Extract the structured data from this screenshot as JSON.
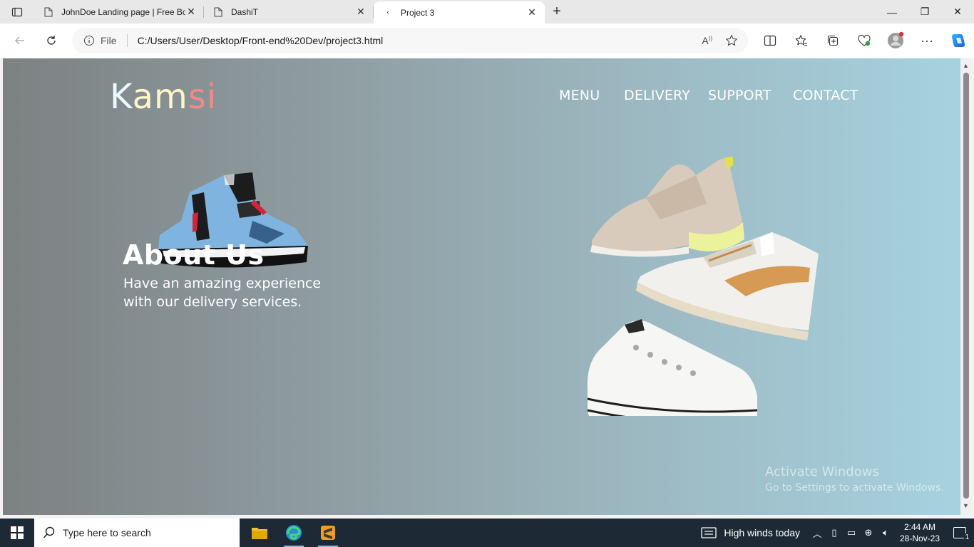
{
  "browser": {
    "tabs": [
      {
        "title": "JohnDoe Landing page | Free Bo",
        "active": false
      },
      {
        "title": "DashiT",
        "active": false
      },
      {
        "title": "Project 3",
        "active": true
      }
    ],
    "address": {
      "scheme_label": "File",
      "url": "C:/Users/User/Desktop/Front-end%20Dev/project3.html"
    }
  },
  "page": {
    "logo": {
      "part1": "K",
      "part2": "am",
      "part3": "si"
    },
    "nav": [
      "MENU",
      "DELIVERY",
      "SUPPORT",
      "CONTACT"
    ],
    "hero": {
      "title": "About Us",
      "subtitle": "Have an amazing experience with our delivery services."
    },
    "watermark": {
      "line1": "Activate Windows",
      "line2": "Go to Settings to activate Windows."
    }
  },
  "taskbar": {
    "search_placeholder": "Type here to search",
    "weather": "High winds today",
    "time": "2:44 AM",
    "date": "28-Nov-23",
    "notification_count": "1"
  },
  "colors": {
    "gradient_left": "#7d8182",
    "gradient_right": "#a6d2df",
    "logo_k": "#e9fbff",
    "logo_am": "#fff6c8",
    "logo_si": "#f08a8a"
  }
}
